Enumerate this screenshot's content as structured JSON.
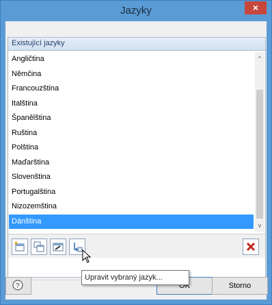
{
  "window": {
    "title": "Jazyky",
    "close_glyph": "×"
  },
  "group": {
    "header": "Existující jazyky"
  },
  "languages": [
    {
      "label": "Angličtina",
      "selected": false
    },
    {
      "label": "Němčina",
      "selected": false
    },
    {
      "label": "Francouzština",
      "selected": false
    },
    {
      "label": "Italština",
      "selected": false
    },
    {
      "label": "Španělština",
      "selected": false
    },
    {
      "label": "Ruština",
      "selected": false
    },
    {
      "label": "Polština",
      "selected": false
    },
    {
      "label": "Maďarština",
      "selected": false
    },
    {
      "label": "Slovenština",
      "selected": false
    },
    {
      "label": "Portugalština",
      "selected": false
    },
    {
      "label": "Nizozemština",
      "selected": false
    },
    {
      "label": "Dánština",
      "selected": true
    }
  ],
  "scrollbar": {
    "up_glyph": "^",
    "down_glyph": "v"
  },
  "toolbar": {
    "buttons": [
      {
        "icon": "new-language-icon"
      },
      {
        "icon": "copy-language-icon"
      },
      {
        "icon": "edit-language-icon"
      },
      {
        "icon": "import-language-icon"
      },
      {
        "icon": "delete-icon"
      }
    ],
    "tooltip": "Upravit vybraný jazyk..."
  },
  "footer": {
    "help_icon": "help-icon",
    "ok_label": "OK",
    "cancel_label": "Storno"
  },
  "colors": {
    "title_bar": "#5b9bd5",
    "close_button": "#c7473c",
    "selection": "#3399ff",
    "delete_icon": "#c0261c"
  }
}
